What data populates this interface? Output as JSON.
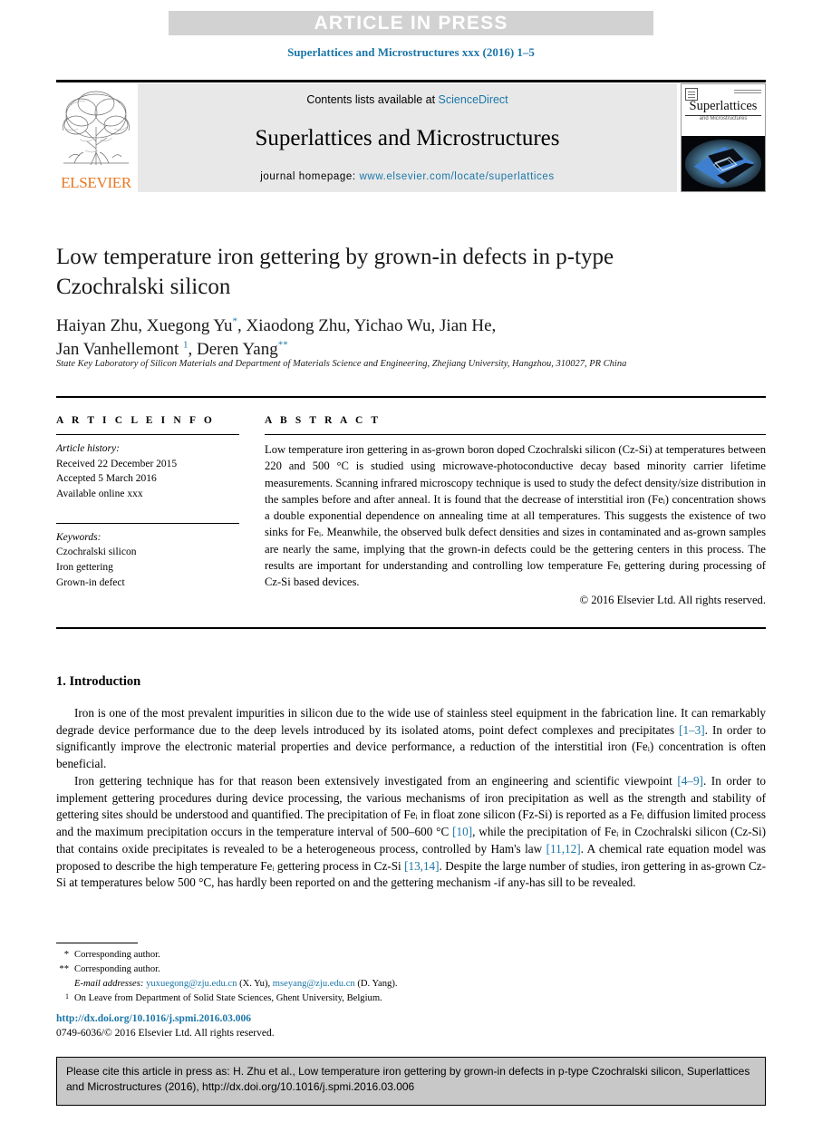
{
  "banner": {
    "article_in_press": "ARTICLE IN PRESS",
    "masthead": "Superlattices and Microstructures xxx (2016) 1–5"
  },
  "journal_header": {
    "contents_prefix": "Contents lists available at ",
    "sciencedirect": "ScienceDirect",
    "journal_name": "Superlattices and Microstructures",
    "homepage_prefix": "journal homepage: ",
    "homepage_url": "www.elsevier.com/locate/superlattices",
    "publisher": "ELSEVIER",
    "cover_title": "Superlattices",
    "cover_subtitle": "and Microstructures"
  },
  "article": {
    "title": "Low temperature iron gettering by grown-in defects in p-type Czochralski silicon",
    "authors": "Haiyan Zhu, Xuegong Yu",
    "authors_line1_rest": ", Xiaodong Zhu, Yichao Wu, Jian He,",
    "authors_line2_a": "Jan Vanhellemont ",
    "authors_line2_b": ", Deren Yang",
    "author_mark_1": "*",
    "author_mark_2": "1",
    "author_mark_3": "**",
    "affiliation": "State Key Laboratory of Silicon Materials and Department of Materials Science and Engineering, Zhejiang University, Hangzhou, 310027, PR China"
  },
  "article_info": {
    "heading": "A R T I C L E  I N F O",
    "history_label": "Article history:",
    "history": [
      "Received 22 December 2015",
      "Accepted 5 March 2016",
      "Available online xxx"
    ],
    "keywords_label": "Keywords:",
    "keywords": [
      "Czochralski silicon",
      "Iron gettering",
      "Grown-in defect"
    ]
  },
  "abstract": {
    "heading": "A B S T R A C T",
    "text": "Low temperature iron gettering in as-grown boron doped Czochralski silicon (Cz-Si) at temperatures between 220 and 500 °C is studied using microwave-photoconductive decay based minority carrier lifetime measurements. Scanning infrared microscopy technique is used to study the defect density/size distribution in the samples before and after anneal. It is found that the decrease of interstitial iron (Feᵢ) concentration shows a double exponential dependence on annealing time at all temperatures. This suggests the existence of two sinks for Feᵢ. Meanwhile, the observed bulk defect densities and sizes in contaminated and as-grown samples are nearly the same, implying that the grown-in defects could be the gettering centers in this process. The results are important for understanding and controlling low temperature Feᵢ gettering during processing of Cz-Si based devices.",
    "copyright": "© 2016 Elsevier Ltd. All rights reserved."
  },
  "body": {
    "section_title": "1. Introduction",
    "paragraph1_a": "Iron is one of the most prevalent impurities in silicon due to the wide use of stainless steel equipment in the fabrication line. It can remarkably degrade device performance due to the deep levels introduced by its isolated atoms, point defect complexes and precipitates ",
    "ref_1_3": "[1–3]",
    "paragraph1_b": ". In order to significantly improve the electronic material properties and device performance, a reduction of the interstitial iron (Feᵢ) concentration is often beneficial.",
    "paragraph2_a": "Iron gettering technique has for that reason been extensively investigated from an engineering and scientific viewpoint ",
    "ref_4_9": "[4–9]",
    "paragraph2_b": ". In order to implement gettering procedures during device processing, the various mechanisms of iron precipitation as well as the strength and stability of gettering sites should be understood and quantified. The precipitation of Feᵢ in float zone silicon (Fz-Si) is reported as a Feᵢ diffusion limited process and the maximum precipitation occurs in the temperature interval of 500–600 °C ",
    "ref_10": "[10]",
    "paragraph2_c": ", while the precipitation of Feᵢ in Czochralski silicon (Cz-Si) that contains oxide precipitates is revealed to be a heterogeneous process, controlled by Ham's law ",
    "ref_11_12": "[11,12]",
    "paragraph2_d": ". A chemical rate equation model was proposed to describe the high temperature Feᵢ gettering process in Cz-Si ",
    "ref_13_14": "[13,14]",
    "paragraph2_e": ". Despite the large number of studies, iron gettering in as-grown Cz-Si at temperatures below 500 °C, has hardly been reported on and the gettering mechanism -if any-has sill to be revealed."
  },
  "footnotes": {
    "mark1": "*",
    "note1": "Corresponding author.",
    "mark2": "**",
    "note2": "Corresponding author.",
    "email_label": "E-mail addresses:",
    "email1": "yuxuegong@zju.edu.cn",
    "email1_name": " (X. Yu), ",
    "email2": "mseyang@zju.edu.cn",
    "email2_name": " (D. Yang).",
    "mark3": "1",
    "note3": "On Leave from Department of Solid State Sciences, Ghent University, Belgium.",
    "doi": "http://dx.doi.org/10.1016/j.spmi.2016.03.006",
    "issn": "0749-6036/© 2016 Elsevier Ltd. All rights reserved."
  },
  "citation_box": {
    "text": "Please cite this article in press as: H. Zhu et al., Low temperature iron gettering by grown-in defects in p-type Czochralski silicon, Superlattices and Microstructures (2016), http://dx.doi.org/10.1016/j.spmi.2016.03.006"
  },
  "colors": {
    "link": "#1b76a8",
    "banner_bg": "#d2d2d2",
    "contents_bg": "#e8e8e8",
    "cite_bg": "#c8c8c8",
    "elsevier_orange": "#e87722"
  }
}
